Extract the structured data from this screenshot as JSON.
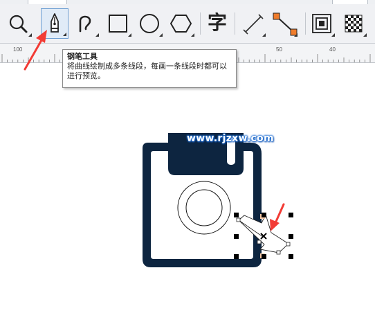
{
  "toolbar": {
    "tools": [
      {
        "name": "zoom",
        "icon": "magnifier-icon"
      },
      {
        "name": "pen",
        "icon": "pen-nib-icon",
        "active": true
      },
      {
        "name": "freehand",
        "icon": "curve-hook-icon"
      },
      {
        "name": "rectangle",
        "icon": "rectangle-icon"
      },
      {
        "name": "ellipse",
        "icon": "ellipse-icon"
      },
      {
        "name": "polygon",
        "icon": "hexagon-icon"
      },
      {
        "name": "text",
        "icon": "text-char-icon",
        "glyph": "字"
      },
      {
        "name": "dimension",
        "icon": "dimension-line-icon"
      },
      {
        "name": "connector",
        "icon": "connector-icon"
      },
      {
        "name": "contour",
        "icon": "contour-icon"
      },
      {
        "name": "pattern",
        "icon": "checkerboard-icon"
      }
    ]
  },
  "ruler": {
    "labels": [
      "100",
      "50",
      "40"
    ]
  },
  "tooltip": {
    "title": "钢笔工具",
    "description": "将曲线绘制成多条线段，每画一条线段时都可以进行预览。"
  },
  "watermark": {
    "text": "www.rjzxw.com"
  },
  "colors": {
    "shape_fill": "#0d2540",
    "handle": "#000000",
    "annotation_arrow": "#f23b35",
    "connector_node": "#f07c2b",
    "tooltip_border": "#8a8a8a",
    "active_tool_bg": "#e0ebf7",
    "active_tool_border": "#6e9fd3"
  }
}
